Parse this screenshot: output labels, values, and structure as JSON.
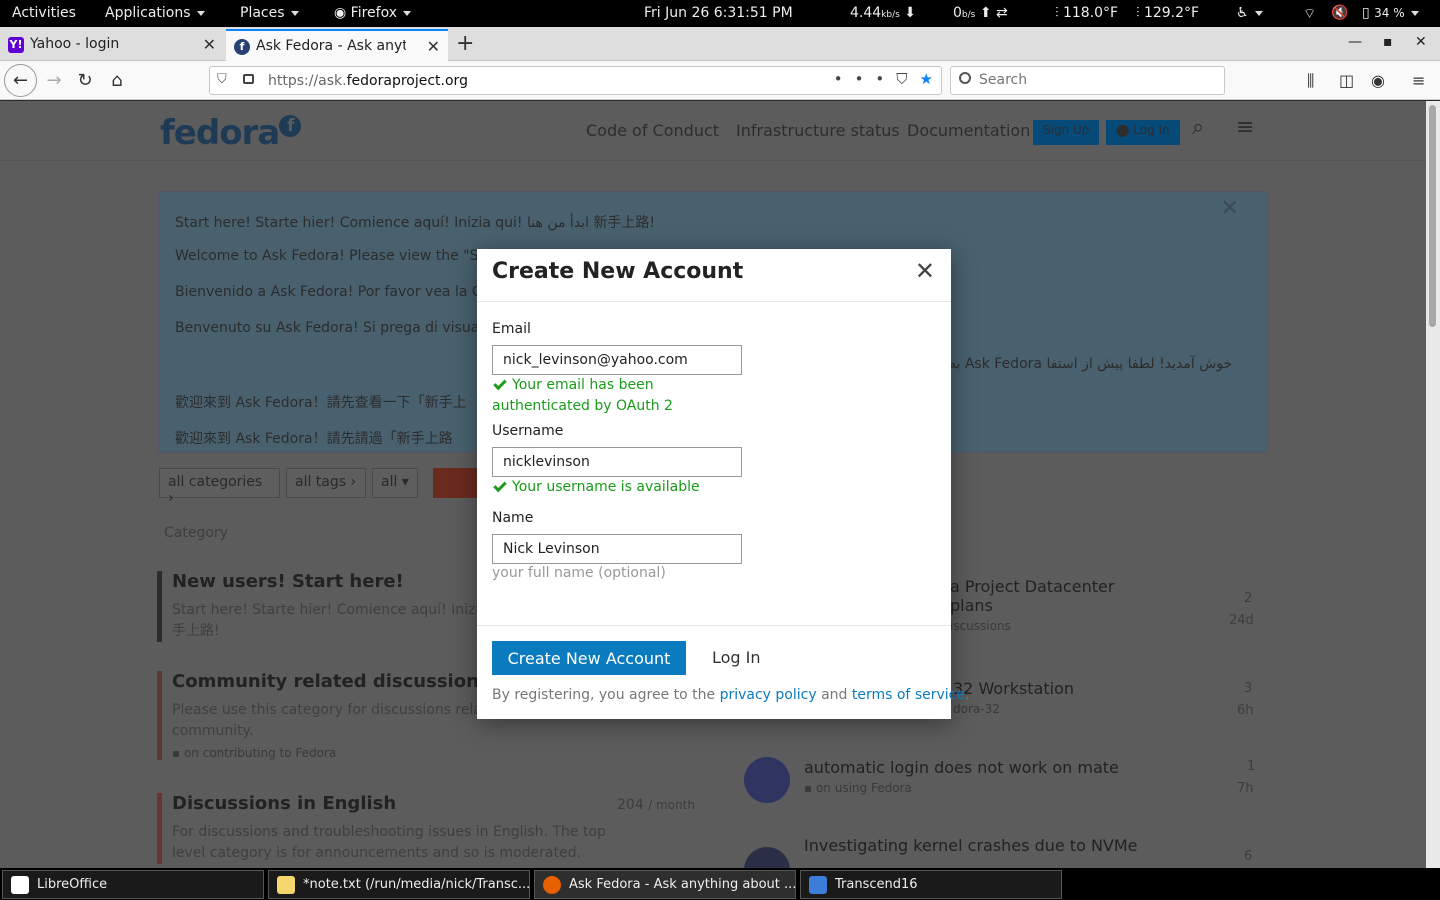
{
  "system_bar": {
    "activities": "Activities",
    "applications": "Applications",
    "places": "Places",
    "firefox": "Firefox",
    "datetime": "Fri Jun 26  6:31:51 PM",
    "net_down": "4.44",
    "net_down_unit": "kb/s",
    "net_up": "0",
    "net_up_unit": "b/s",
    "temp1": "118.0°F",
    "temp2": "129.2°F",
    "battery": "34 %"
  },
  "browser": {
    "tabs": [
      {
        "label": "Yahoo - login",
        "favicon": "Y!",
        "color": "#6001d2"
      },
      {
        "label": "Ask Fedora - Ask anything about Fedora",
        "favicon": "f",
        "color": "#294172"
      }
    ],
    "url_prefix": "https://ask.",
    "url_main": "fedoraproject.org",
    "search_placeholder": "Search"
  },
  "page": {
    "logo": "fedora",
    "nav": [
      "Code of Conduct",
      "Infrastructure status",
      "Documentation"
    ],
    "signup": "Sign Up",
    "login": "Log In",
    "banner_lines": [
      "Start here! Starte hier! Comience aquí! Inizia qui! ابدأ من هنا 新手上路!",
      "Welcome to Ask Fedora! Please view the \"St",
      "Bienvenido a Ask Fedora! Por favor vea la Ca",
      "Benvenuto su Ask Fedora! Si prega di visualiz",
      "歡迎來到 Ask Fedora！請先查看一下「新手上",
      "歡迎來到 Ask Fedora！請先請過「新手上路",
      "به Ask Fedora خوش آمدید! لطفا پیش از استفا"
    ],
    "filters": [
      "all categories",
      "all tags",
      "all"
    ],
    "category_label": "Category",
    "categories": [
      {
        "title": "New users! Start here!",
        "desc": "Start here! Starte hier! Comience aquí! Inizia q",
        "desc2": "手上路!",
        "sub": ""
      },
      {
        "title": "Community related discussions",
        "desc": "Please use this category for discussions relate",
        "desc2": "community.",
        "sub": "on contributing to Fedora"
      },
      {
        "title": "Discussions in English",
        "desc": "For discussions and troubleshooting issues in English. The top",
        "desc2": "level category is for announcements and so is moderated.",
        "sub": ""
      }
    ],
    "english_count": "204",
    "english_count_unit": "/ month",
    "topics": [
      {
        "title": "a Project Datacenter",
        "title2": "plans",
        "sub": "iscussions",
        "count": "2",
        "age": "24d"
      },
      {
        "title": "32 Workstation",
        "title2": "",
        "sub": "dora-32",
        "count": "3",
        "age": "6h"
      },
      {
        "title": "automatic login does not work on mate",
        "title2": "",
        "sub": "on using Fedora",
        "count": "1",
        "age": "7h"
      },
      {
        "title": "Investigating kernel crashes due to NVMe",
        "title2": "",
        "sub": "",
        "count": "6",
        "age": ""
      }
    ]
  },
  "modal": {
    "title": "Create New Account",
    "email_label": "Email",
    "email_value": "nick_levinson@yahoo.com",
    "email_ok": "Your email has been authenticated by OAuth 2",
    "username_label": "Username",
    "username_value": "nicklevinson",
    "username_ok": "Your username is available",
    "name_label": "Name",
    "name_value": "Nick Levinson",
    "name_hint": "your full name (optional)",
    "create_button": "Create New Account",
    "login_button": "Log In",
    "legal_prefix": "By registering, you agree to the ",
    "privacy": "privacy policy",
    "legal_and": " and ",
    "terms": "terms of service",
    "legal_end": "."
  },
  "taskbar": [
    {
      "label": "LibreOffice",
      "icon_color": "#ffffff"
    },
    {
      "label": "*note.txt (/run/media/nick/Transc...",
      "icon_color": "#f5d76e"
    },
    {
      "label": "Ask Fedora - Ask anything about ...",
      "icon_color": "#e66000"
    },
    {
      "label": "Transcend16",
      "icon_color": "#3b7dd8"
    }
  ]
}
